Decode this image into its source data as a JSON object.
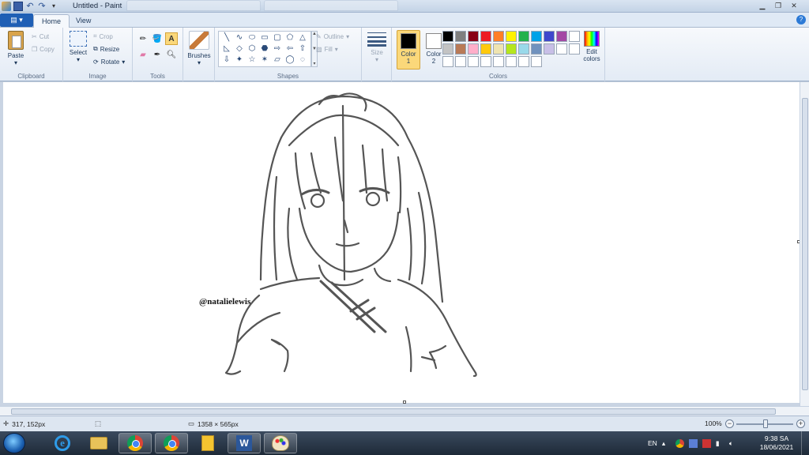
{
  "window": {
    "title": "Untitled - Paint",
    "controls": [
      "minimize",
      "maximize",
      "close"
    ]
  },
  "quick_access": {
    "icons": [
      "paint-app-icon",
      "save-icon",
      "undo-icon",
      "redo-icon",
      "customize-icon"
    ]
  },
  "ribbon_tabs": {
    "file": "",
    "home": "Home",
    "view": "View"
  },
  "ribbon": {
    "clipboard": {
      "label": "Clipboard",
      "paste": "Paste",
      "cut": "Cut",
      "copy": "Copy"
    },
    "image": {
      "label": "Image",
      "select": "Select",
      "crop": "Crop",
      "resize": "Resize",
      "rotate": "Rotate"
    },
    "tools": {
      "label": "Tools",
      "items": [
        "pencil",
        "fill",
        "text",
        "eraser",
        "color-picker",
        "magnifier"
      ],
      "selected": "text"
    },
    "brushes": {
      "label": "Brushes"
    },
    "shapes": {
      "label": "Shapes",
      "glyphs": [
        "╲",
        "∿",
        "⬭",
        "▭",
        "▢",
        "⬠",
        "△",
        "◺",
        "◇",
        "⬡",
        "⬣",
        "⇨",
        "⇦",
        "⇧",
        "⇩",
        "✦",
        "☆",
        "✶",
        "▱",
        "◯",
        "◌"
      ],
      "outline": "Outline",
      "fill": "Fill"
    },
    "size": {
      "label": "Size"
    },
    "colors": {
      "label": "Colors",
      "color1_label": "Color",
      "color1_num": "1",
      "color1": "#000000",
      "color2_label": "Color",
      "color2_num": "2",
      "color2": "#ffffff",
      "edit": "Edit",
      "edit2": "colors",
      "palette": [
        "#000000",
        "#7f7f7f",
        "#880015",
        "#ed1c24",
        "#ff7f27",
        "#fff200",
        "#22b14c",
        "#00a2e8",
        "#3f48cc",
        "#a349a4",
        "#ffffff",
        "#c3c3c3",
        "#b97a57",
        "#ffaec9",
        "#ffc90e",
        "#efe4b0",
        "#b5e61d",
        "#99d9ea",
        "#7092be",
        "#c8bfe7",
        "#ffffff",
        "#ffffff",
        "#ffffff",
        "#ffffff",
        "#ffffff",
        "#ffffff",
        "#ffffff",
        "#ffffff",
        "#ffffff",
        "#ffffff"
      ]
    }
  },
  "canvas": {
    "watermark": "@natalielewis"
  },
  "status": {
    "cursor_pos": "317, 152px",
    "selection_size": "",
    "image_size": "1358 × 565px",
    "zoom": "100%"
  },
  "taskbar": {
    "apps": [
      "internet-explorer",
      "file-explorer",
      "chrome",
      "chrome",
      "sticky-notes",
      "word",
      "paint"
    ],
    "language": "EN",
    "time": "9:38 SA",
    "date": "18/06/2021"
  }
}
